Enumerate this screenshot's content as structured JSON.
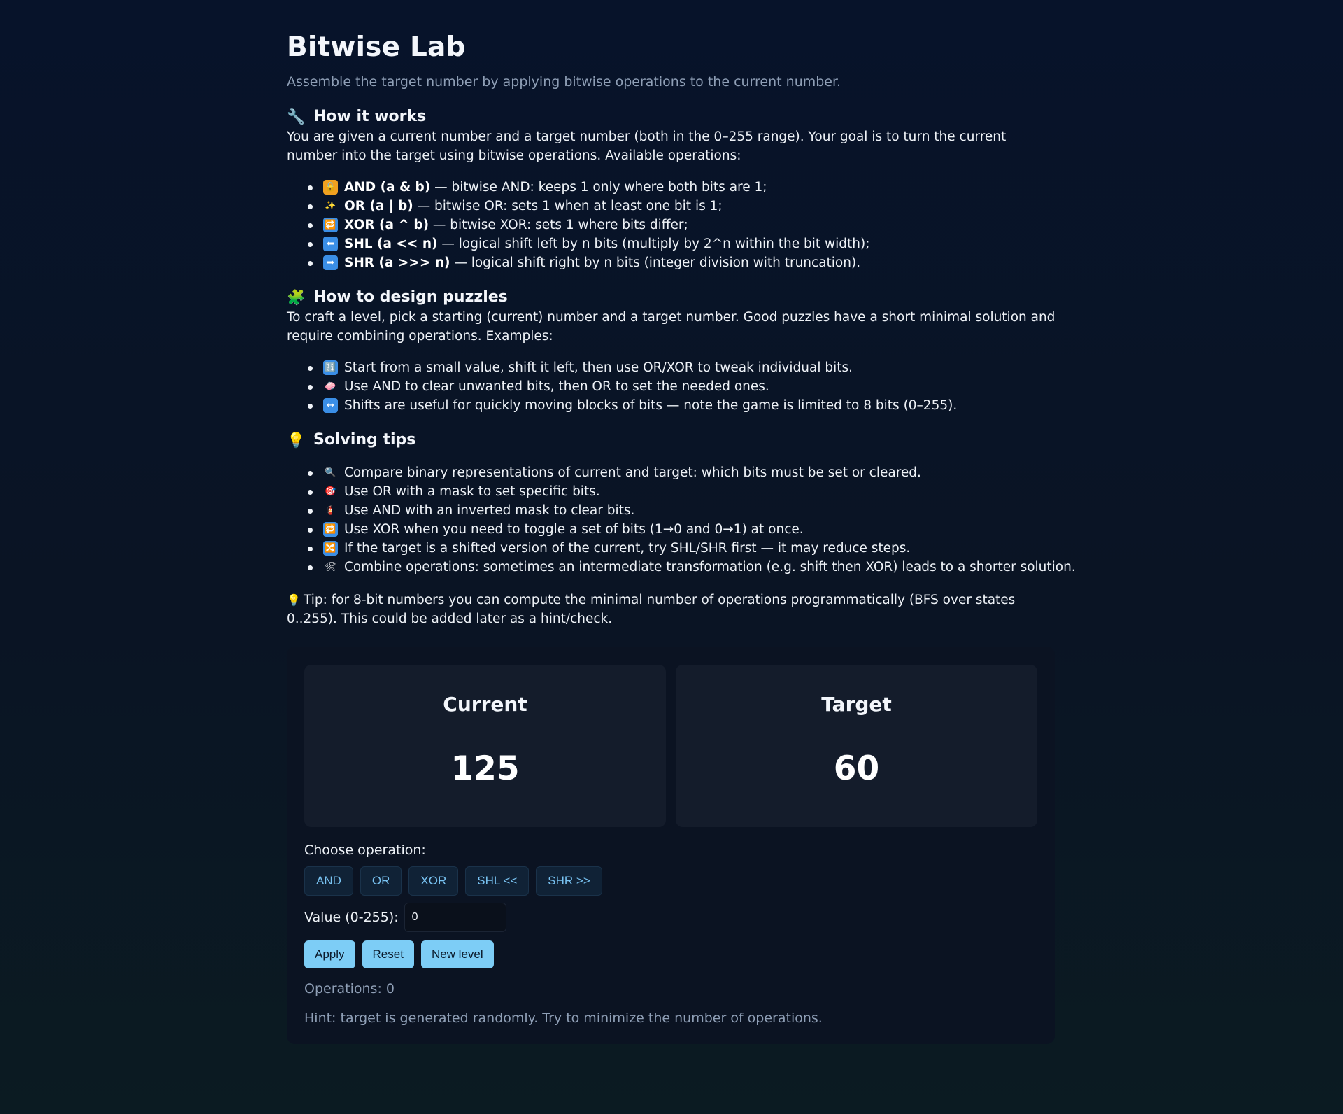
{
  "header": {
    "title": "Bitwise Lab",
    "subtitle": "Assemble the target number by applying bitwise operations to the current number."
  },
  "how_it_works": {
    "icon": "wrench-icon",
    "glyph": "🔧",
    "heading": "How it works",
    "intro": "You are given a current number and a target number (both in the 0–255 range). Your goal is to turn the current number into the target using bitwise operations. Available operations:",
    "items": [
      {
        "icon": "lock-icon",
        "glyph": "🔒",
        "bg": "#f0a020",
        "name": "AND (a & b)",
        "desc": " — bitwise AND: keeps 1 only where both bits are 1;"
      },
      {
        "icon": "sparkles-icon",
        "glyph": "✨",
        "bg": "transparent",
        "name": "OR (a | b)",
        "desc": " — bitwise OR: sets 1 when at least one bit is 1;"
      },
      {
        "icon": "repeat-icon",
        "glyph": "🔁",
        "bg": "#3a8ee6",
        "name": "XOR (a ^ b)",
        "desc": " — bitwise XOR: sets 1 where bits differ;"
      },
      {
        "icon": "arrow-left-icon",
        "glyph": "⬅",
        "bg": "#3a8ee6",
        "name": "SHL (a << n)",
        "desc": " — logical shift left by n bits (multiply by 2^n within the bit width);"
      },
      {
        "icon": "arrow-right-icon",
        "glyph": "➡",
        "bg": "#3a8ee6",
        "name": "SHR (a >>> n)",
        "desc": " — logical shift right by n bits (integer division with truncation)."
      }
    ]
  },
  "design": {
    "icon": "puzzle-icon",
    "glyph": "🧩",
    "heading": "How to design puzzles",
    "intro": "To craft a level, pick a starting (current) number and a target number. Good puzzles have a short minimal solution and require combining operations. Examples:",
    "items": [
      {
        "icon": "numbers-icon",
        "glyph": "🔢",
        "bg": "#3a8ee6",
        "text": "Start from a small value, shift it left, then use OR/XOR to tweak individual bits."
      },
      {
        "icon": "gem-icon",
        "glyph": "🧼",
        "bg": "transparent",
        "text": "Use AND to clear unwanted bits, then OR to set the needed ones."
      },
      {
        "icon": "left-right-arrow-icon",
        "glyph": "↔",
        "bg": "#3a8ee6",
        "text": "Shifts are useful for quickly moving blocks of bits — note the game is limited to 8 bits (0–255)."
      }
    ]
  },
  "tips": {
    "icon": "lightbulb-icon",
    "glyph": "💡",
    "heading": "Solving tips",
    "items": [
      {
        "icon": "magnifier-icon",
        "glyph": "🔍",
        "bg": "transparent",
        "text": "Compare binary representations of current and target: which bits must be set or cleared."
      },
      {
        "icon": "target-icon",
        "glyph": "🎯",
        "bg": "transparent",
        "text": "Use OR with a mask to set specific bits."
      },
      {
        "icon": "extinguisher-icon",
        "glyph": "🧯",
        "bg": "transparent",
        "text": "Use AND with an inverted mask to clear bits."
      },
      {
        "icon": "repeat-icon",
        "glyph": "🔁",
        "bg": "#3a8ee6",
        "text": "Use XOR when you need to toggle a set of bits (1→0 and 0→1) at once."
      },
      {
        "icon": "shuffle-icon",
        "glyph": "🔀",
        "bg": "#3a8ee6",
        "text": "If the target is a shifted version of the current, try SHL/SHR first — it may reduce steps."
      },
      {
        "icon": "tools-icon",
        "glyph": "🛠",
        "bg": "transparent",
        "text": "Combine operations: sometimes an intermediate transformation (e.g. shift then XOR) leads to a shorter solution."
      }
    ],
    "footer_icon": "lightbulb-icon",
    "footer_glyph": "💡",
    "footer_text": "Tip: for 8-bit numbers you can compute the minimal number of operations programmatically (BFS over states 0..255). This could be added later as a hint/check."
  },
  "game": {
    "current_label": "Current",
    "current_value": "125",
    "target_label": "Target",
    "target_value": "60",
    "choose_label": "Choose operation:",
    "operations": [
      "AND",
      "OR",
      "XOR",
      "SHL <<",
      "SHR >>"
    ],
    "value_label": "Value (0-255):",
    "value_input": "0",
    "apply_label": "Apply",
    "reset_label": "Reset",
    "new_level_label": "New level",
    "operations_count": "Operations: 0",
    "hint": "Hint: target is generated randomly. Try to minimize the number of operations."
  },
  "colors": {
    "accent": "#7dcdf6",
    "op_text": "#79c3f2",
    "background": "#07132a",
    "card": "#141c2b"
  }
}
